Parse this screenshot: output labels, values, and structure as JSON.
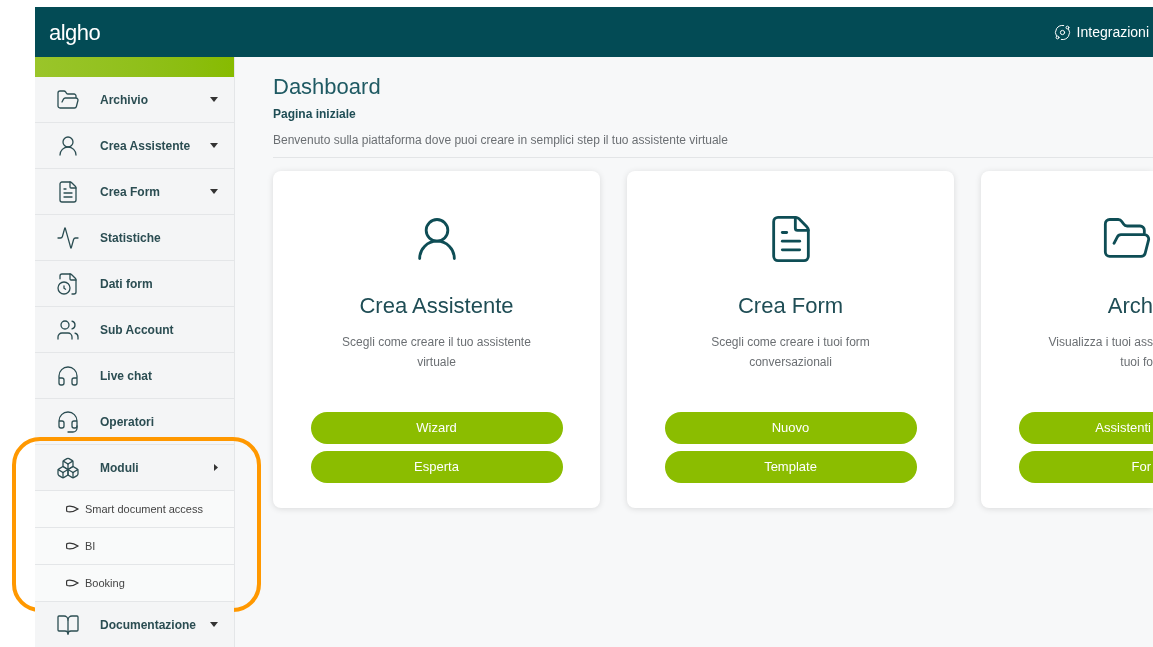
{
  "header": {
    "logo": "algho",
    "integrations_label": "Integrazioni"
  },
  "sidebar": {
    "items": [
      {
        "label": "Archivio",
        "expanded": false,
        "highlighted": false
      },
      {
        "label": "Crea Assistente",
        "expanded": false,
        "highlighted": false
      },
      {
        "label": "Crea Form",
        "expanded": false,
        "highlighted": false
      },
      {
        "label": "Statistiche",
        "highlighted": false
      },
      {
        "label": "Dati form",
        "highlighted": false
      },
      {
        "label": "Sub Account",
        "highlighted": false
      },
      {
        "label": "Live chat",
        "highlighted": false
      },
      {
        "label": "Operatori",
        "highlighted": false
      },
      {
        "label": "Moduli",
        "expanded": true,
        "highlighted": true,
        "children": [
          {
            "label": "Smart document access"
          },
          {
            "label": "BI"
          },
          {
            "label": "Booking"
          }
        ]
      },
      {
        "label": "Documentazione",
        "expanded": false,
        "highlighted": false
      }
    ]
  },
  "page": {
    "title": "Dashboard",
    "subtitle": "Pagina iniziale",
    "description": "Benvenuto sulla piattaforma dove puoi creare in semplici step il tuo assistente virtuale"
  },
  "cards": [
    {
      "title": "Crea Assistente",
      "text_lines": [
        "Scegli come creare il tuo assistente",
        "virtuale"
      ],
      "buttons": [
        "Wizard",
        "Esperta"
      ]
    },
    {
      "title": "Crea Form",
      "text_lines": [
        "Scegli come creare i tuoi form",
        "conversazionali"
      ],
      "buttons": [
        "Nuovo",
        "Template"
      ]
    },
    {
      "title": "Arch",
      "text_lines": [
        "Visualizza i tuoi ass",
        "tuoi fo"
      ],
      "buttons": [
        "Assistenti",
        "For"
      ]
    }
  ]
}
